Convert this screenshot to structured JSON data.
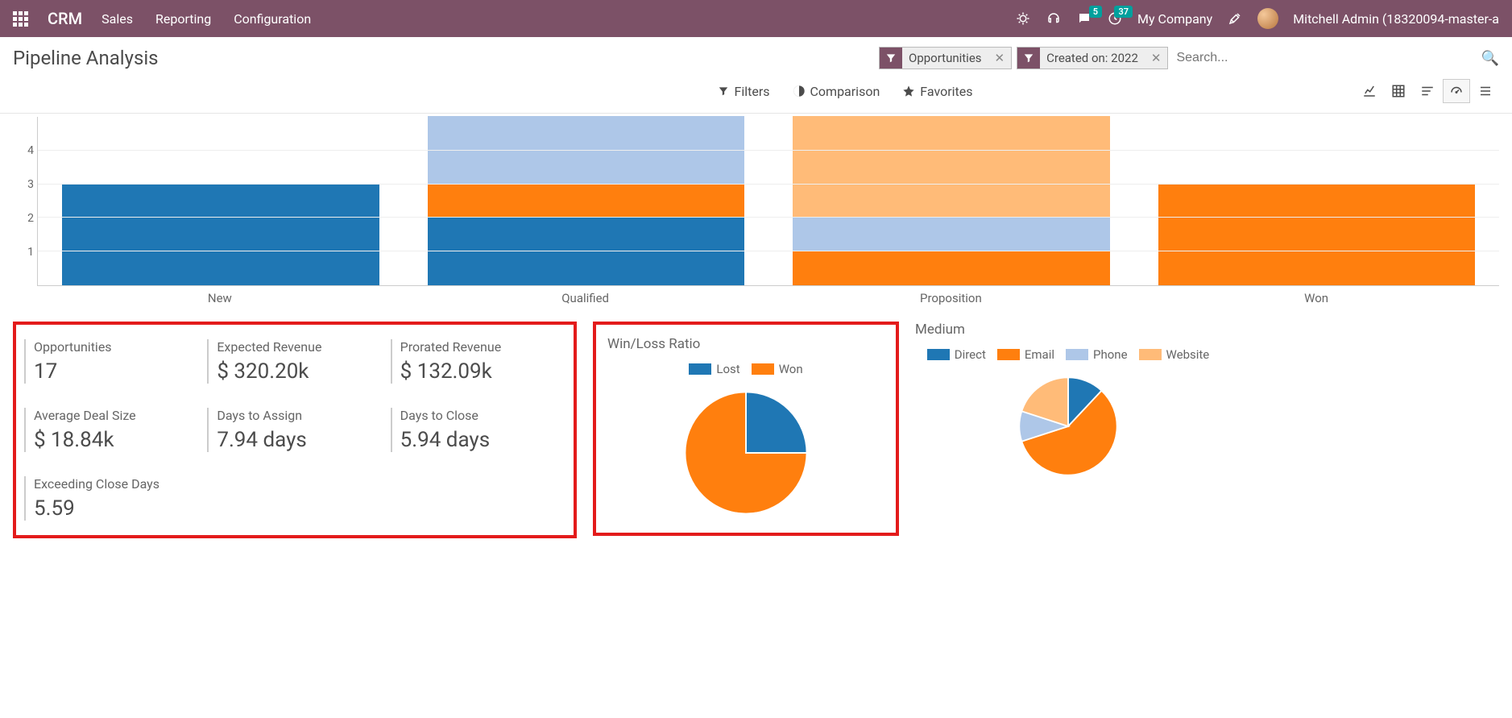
{
  "topnav": {
    "brand": "CRM",
    "menu": [
      "Sales",
      "Reporting",
      "Configuration"
    ],
    "messages_badge": "5",
    "activities_badge": "37",
    "company": "My Company",
    "user": "Mitchell Admin (18320094-master-a"
  },
  "control_panel": {
    "title": "Pipeline Analysis",
    "chips": [
      {
        "label": "Opportunities"
      },
      {
        "label": "Created on: 2022"
      }
    ],
    "search_placeholder": "Search...",
    "buttons": {
      "filters": "Filters",
      "comparison": "Comparison",
      "favorites": "Favorites"
    }
  },
  "stats": [
    {
      "label": "Opportunities",
      "value": "17"
    },
    {
      "label": "Expected Revenue",
      "value": "$ 320.20k"
    },
    {
      "label": "Prorated Revenue",
      "value": "$ 132.09k"
    },
    {
      "label": "Average Deal Size",
      "value": "$ 18.84k"
    },
    {
      "label": "Days to Assign",
      "value": "7.94 days"
    },
    {
      "label": "Days to Close",
      "value": "5.94 days"
    },
    {
      "label": "Exceeding Close Days",
      "value": "5.59"
    }
  ],
  "pies": {
    "winloss": {
      "title": "Win/Loss Ratio",
      "legend": [
        "Lost",
        "Won"
      ]
    },
    "medium": {
      "title": "Medium",
      "legend": [
        "Direct",
        "Email",
        "Phone",
        "Website"
      ]
    }
  },
  "colors": {
    "blue": "#1f77b4",
    "orange": "#ff7f0e",
    "lightblue": "#aec7e8",
    "lightorange": "#ffbb78"
  },
  "chart_data": [
    {
      "type": "bar",
      "stacked": true,
      "categories": [
        "New",
        "Qualified",
        "Proposition",
        "Won"
      ],
      "series": [
        {
          "name": "s1-blue",
          "color": "#1f77b4",
          "values": [
            3,
            2,
            0,
            0
          ]
        },
        {
          "name": "s2-orange",
          "color": "#ff7f0e",
          "values": [
            0,
            1,
            1,
            3
          ]
        },
        {
          "name": "s3-lightblue",
          "color": "#aec7e8",
          "values": [
            0,
            2,
            1,
            0
          ]
        },
        {
          "name": "s4-lightorange",
          "color": "#ffbb78",
          "values": [
            0,
            0,
            3,
            0
          ]
        }
      ],
      "ylim": [
        0,
        5
      ],
      "yticks": [
        1,
        2,
        3,
        4
      ]
    },
    {
      "type": "pie",
      "title": "Win/Loss Ratio",
      "series": [
        {
          "name": "Lost",
          "value": 25,
          "color": "#1f77b4"
        },
        {
          "name": "Won",
          "value": 75,
          "color": "#ff7f0e"
        }
      ]
    },
    {
      "type": "pie",
      "title": "Medium",
      "series": [
        {
          "name": "Direct",
          "value": 12,
          "color": "#1f77b4"
        },
        {
          "name": "Email",
          "value": 58,
          "color": "#ff7f0e"
        },
        {
          "name": "Phone",
          "value": 10,
          "color": "#aec7e8"
        },
        {
          "name": "Website",
          "value": 20,
          "color": "#ffbb78"
        }
      ]
    }
  ]
}
